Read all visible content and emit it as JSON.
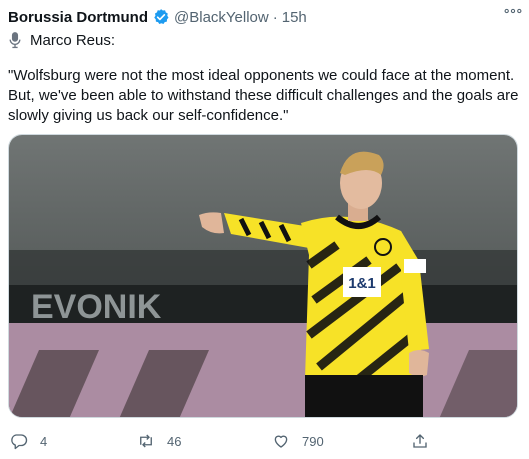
{
  "tweet": {
    "author": {
      "display_name": "Borussia Dortmund",
      "verified_icon": "verified-badge-icon",
      "handle": "@BlackYellow",
      "separator": "·",
      "timestamp": "15h"
    },
    "more_icon": "more-horizontal-icon",
    "speaker": {
      "icon": "microphone-icon",
      "label": "Marco Reus:"
    },
    "text": "\"Wolfsburg were not the most ideal opponents we could face at the moment. But, we've been able to withstand these difficult challenges and the goals are slowly giving us back our self-confidence.\"",
    "media": {
      "sponsor_board_text": "EVONIK",
      "shirt_sponsor": "1&1"
    },
    "actions": {
      "reply_count": "4",
      "retweet_count": "46",
      "like_count": "790",
      "reply_icon": "reply-icon",
      "retweet_icon": "retweet-icon",
      "like_icon": "heart-icon",
      "share_icon": "share-icon"
    }
  },
  "colors": {
    "accent": "#1d9bf0",
    "muted": "#536471",
    "bvb_yellow": "#f7e227",
    "bvb_black": "#111111"
  }
}
